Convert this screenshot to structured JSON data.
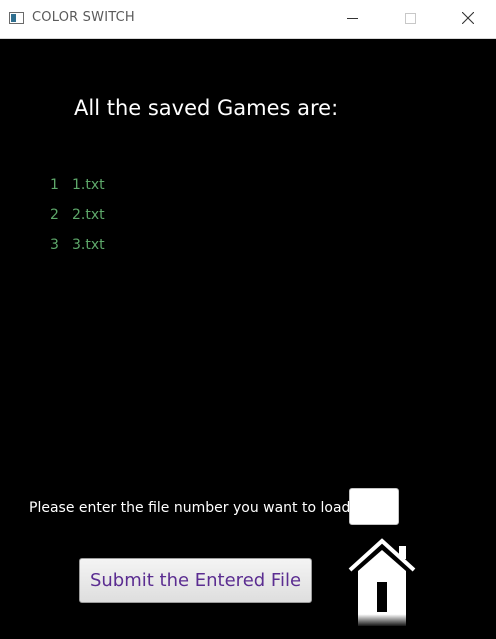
{
  "window": {
    "title": "COLOR SWITCH",
    "icons": {
      "app": "app-window-icon",
      "minimize": "minimize-icon",
      "maximize": "maximize-icon",
      "close": "close-icon"
    }
  },
  "main": {
    "heading": "All the saved Games are:",
    "files": [
      {
        "number": "1",
        "name": "1.txt"
      },
      {
        "number": "2",
        "name": "2.txt"
      },
      {
        "number": "3",
        "name": "3.txt"
      }
    ],
    "prompt": "Please enter the file number you want to load",
    "file_input_value": "",
    "submit_label": "Submit the Entered File",
    "home_icon": "home-icon"
  },
  "colors": {
    "background": "#000000",
    "list_text": "#5ea86a",
    "button_text": "#5b2d91"
  }
}
